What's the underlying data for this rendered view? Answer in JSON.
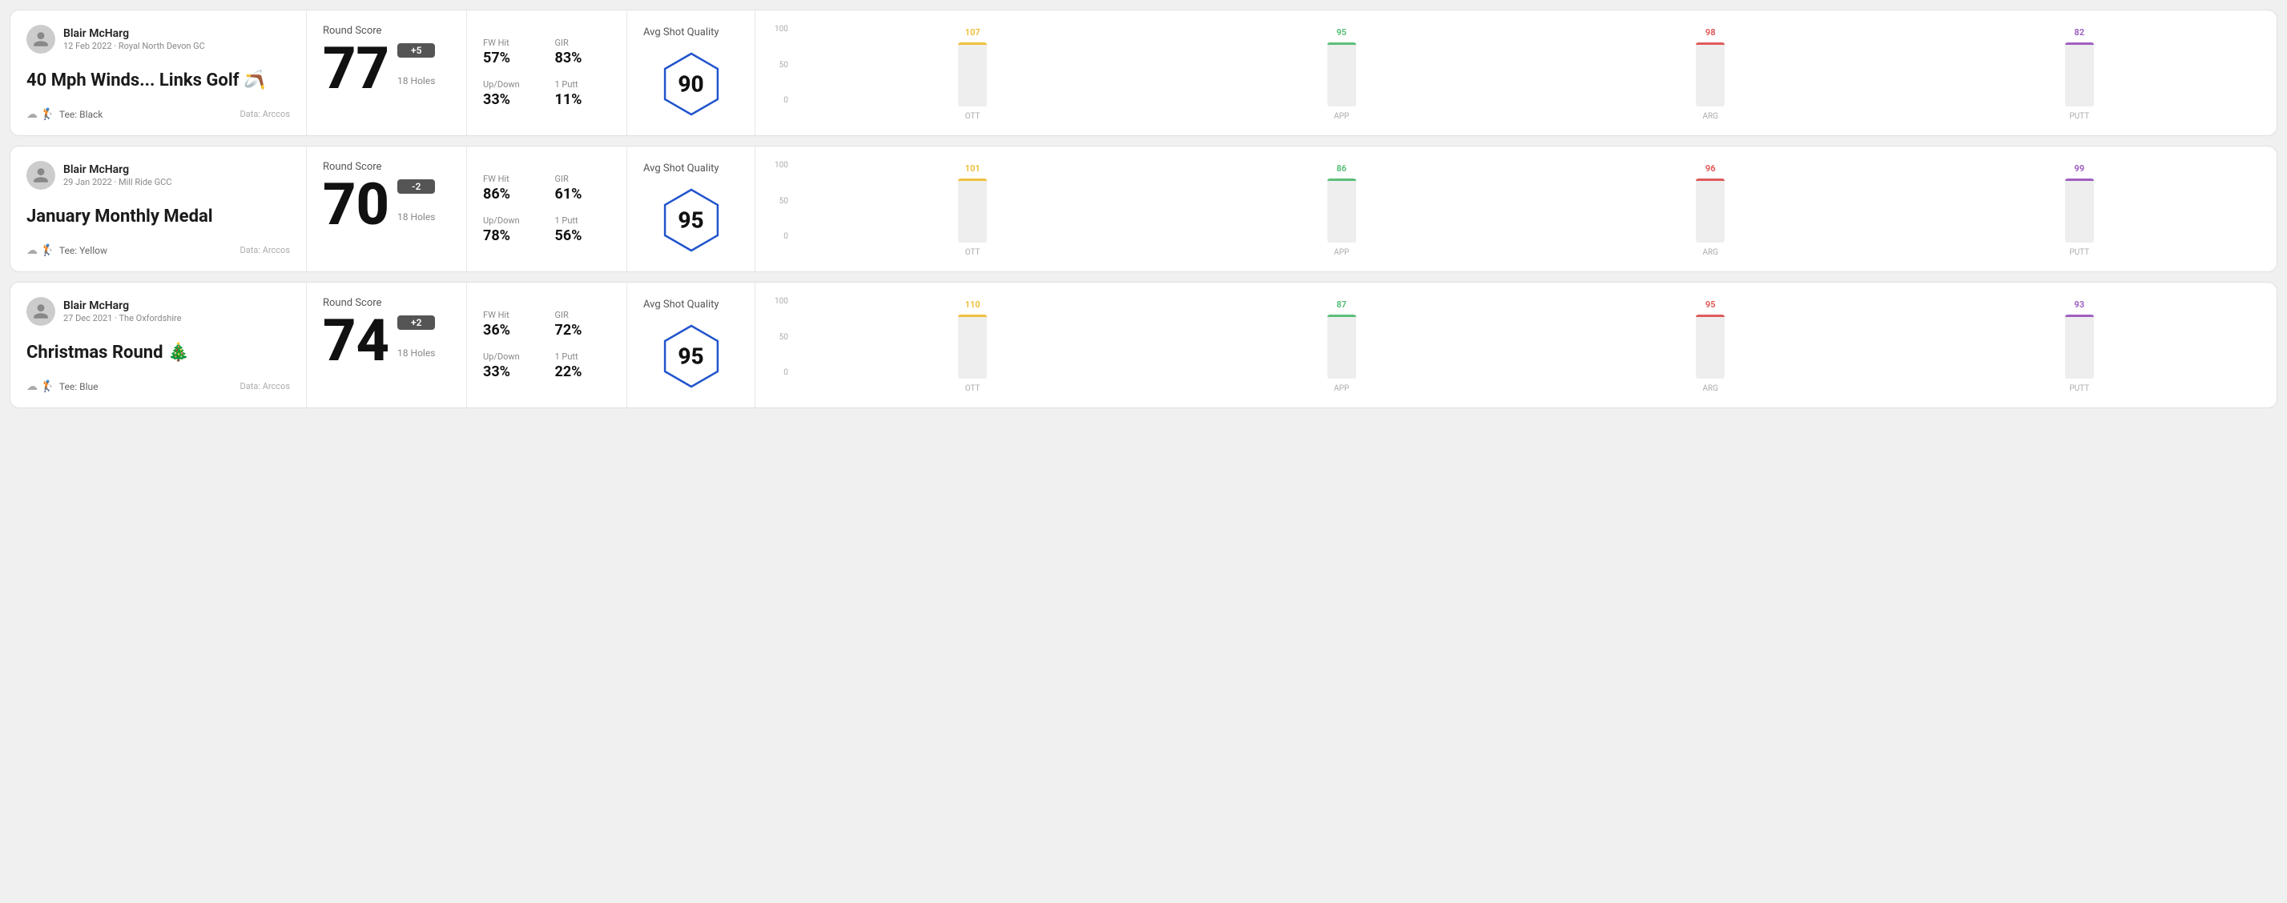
{
  "rounds": [
    {
      "id": "round1",
      "player": {
        "name": "Blair McHarg",
        "date": "12 Feb 2022 · Royal North Devon GC"
      },
      "title": "40 Mph Winds... Links Golf 🪃",
      "tee": "Black",
      "data_source": "Data: Arccos",
      "score": {
        "value": "77",
        "diff": "+5",
        "holes": "18 Holes"
      },
      "stats": {
        "fw_hit_label": "FW Hit",
        "fw_hit_val": "57%",
        "gir_label": "GIR",
        "gir_val": "83%",
        "updown_label": "Up/Down",
        "updown_val": "33%",
        "oneputt_label": "1 Putt",
        "oneputt_val": "11%"
      },
      "quality": {
        "label": "Avg Shot Quality",
        "score": "90"
      },
      "chart": {
        "bars": [
          {
            "label": "OTT",
            "value": 107,
            "color": "#f0c040",
            "pct": 80
          },
          {
            "label": "APP",
            "value": 95,
            "color": "#5bbf7a",
            "pct": 60
          },
          {
            "label": "ARG",
            "value": 98,
            "color": "#e05a5a",
            "pct": 65
          },
          {
            "label": "PUTT",
            "value": 82,
            "color": "#a060c0",
            "pct": 48
          }
        ],
        "y_labels": [
          "100",
          "50",
          "0"
        ]
      }
    },
    {
      "id": "round2",
      "player": {
        "name": "Blair McHarg",
        "date": "29 Jan 2022 · Mill Ride GCC"
      },
      "title": "January Monthly Medal",
      "tee": "Yellow",
      "data_source": "Data: Arccos",
      "score": {
        "value": "70",
        "diff": "-2",
        "holes": "18 Holes"
      },
      "stats": {
        "fw_hit_label": "FW Hit",
        "fw_hit_val": "86%",
        "gir_label": "GIR",
        "gir_val": "61%",
        "updown_label": "Up/Down",
        "updown_val": "78%",
        "oneputt_label": "1 Putt",
        "oneputt_val": "56%"
      },
      "quality": {
        "label": "Avg Shot Quality",
        "score": "95"
      },
      "chart": {
        "bars": [
          {
            "label": "OTT",
            "value": 101,
            "color": "#f0c040",
            "pct": 78
          },
          {
            "label": "APP",
            "value": 86,
            "color": "#5bbf7a",
            "pct": 52
          },
          {
            "label": "ARG",
            "value": 96,
            "color": "#e05a5a",
            "pct": 68
          },
          {
            "label": "PUTT",
            "value": 99,
            "color": "#a060c0",
            "pct": 72
          }
        ],
        "y_labels": [
          "100",
          "50",
          "0"
        ]
      }
    },
    {
      "id": "round3",
      "player": {
        "name": "Blair McHarg",
        "date": "27 Dec 2021 · The Oxfordshire"
      },
      "title": "Christmas Round 🎄",
      "tee": "Blue",
      "data_source": "Data: Arccos",
      "score": {
        "value": "74",
        "diff": "+2",
        "holes": "18 Holes"
      },
      "stats": {
        "fw_hit_label": "FW Hit",
        "fw_hit_val": "36%",
        "gir_label": "GIR",
        "gir_val": "72%",
        "updown_label": "Up/Down",
        "updown_val": "33%",
        "oneputt_label": "1 Putt",
        "oneputt_val": "22%"
      },
      "quality": {
        "label": "Avg Shot Quality",
        "score": "95"
      },
      "chart": {
        "bars": [
          {
            "label": "OTT",
            "value": 110,
            "color": "#f0c040",
            "pct": 85
          },
          {
            "label": "APP",
            "value": 87,
            "color": "#5bbf7a",
            "pct": 53
          },
          {
            "label": "ARG",
            "value": 95,
            "color": "#e05a5a",
            "pct": 66
          },
          {
            "label": "PUTT",
            "value": 93,
            "color": "#a060c0",
            "pct": 62
          }
        ],
        "y_labels": [
          "100",
          "50",
          "0"
        ]
      }
    }
  ]
}
